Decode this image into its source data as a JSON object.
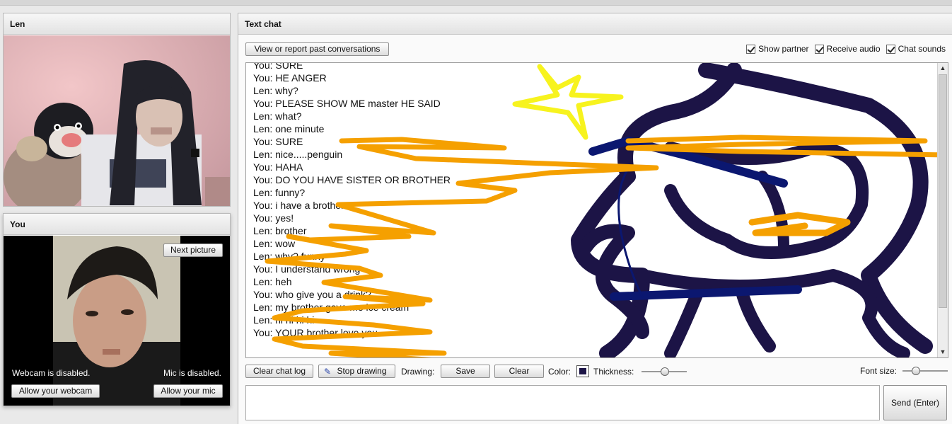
{
  "partner": {
    "name": "Len"
  },
  "self": {
    "title": "You",
    "next_picture_label": "Next picture",
    "webcam_status": "Webcam is disabled.",
    "mic_status": "Mic is disabled.",
    "allow_webcam_label": "Allow your webcam",
    "allow_mic_label": "Allow your mic"
  },
  "chat": {
    "title": "Text chat",
    "view_report_label": "View or report past conversations",
    "options": [
      {
        "label": "Show partner",
        "checked": true
      },
      {
        "label": "Receive audio",
        "checked": true
      },
      {
        "label": "Chat sounds",
        "checked": true
      }
    ],
    "messages": [
      {
        "speaker": "You:",
        "text": "SURE"
      },
      {
        "speaker": "You:",
        "text": "HE ANGER"
      },
      {
        "speaker": "Len:",
        "text": "why?"
      },
      {
        "speaker": "You:",
        "text": "PLEASE SHOW ME master HE SAID"
      },
      {
        "speaker": "Len:",
        "text": "what?"
      },
      {
        "speaker": "Len:",
        "text": "one minute"
      },
      {
        "speaker": "You:",
        "text": "SURE"
      },
      {
        "speaker": "Len:",
        "text": "nice.....penguin"
      },
      {
        "speaker": "You:",
        "text": "HAHA"
      },
      {
        "speaker": "You:",
        "text": "DO YOU HAVE SISTER OR BROTHER"
      },
      {
        "speaker": "Len:",
        "text": "funny?"
      },
      {
        "speaker": "You:",
        "text": "i have a brother"
      },
      {
        "speaker": "You:",
        "text": "yes!"
      },
      {
        "speaker": "Len:",
        "text": "brother"
      },
      {
        "speaker": "Len:",
        "text": "wow"
      },
      {
        "speaker": "Len:",
        "text": "why? funny"
      },
      {
        "speaker": "You:",
        "text": "I understand wrong"
      },
      {
        "speaker": "Len:",
        "text": "heh"
      },
      {
        "speaker": "You:",
        "text": "who give you a drink?"
      },
      {
        "speaker": "Len:",
        "text": "my brother gave me ice cream"
      },
      {
        "speaker": "Len:",
        "text": "hi hi hi hi"
      },
      {
        "speaker": "You:",
        "text": "YOUR brother love you"
      }
    ],
    "toolbar": {
      "clear_log_label": "Clear chat log",
      "stop_drawing_label": "Stop drawing",
      "drawing_label": "Drawing:",
      "save_label": "Save",
      "clear_label": "Clear",
      "color_label": "Color:",
      "thickness_label": "Thickness:",
      "font_size_label": "Font size:"
    },
    "send_label": "Send (Enter)",
    "message_value": ""
  },
  "colors": {
    "drawing_orange": "#f5a000",
    "drawing_navy": "#1c1446",
    "drawing_blue": "#0b1770",
    "drawing_yellow": "#f7f31e"
  },
  "icons": [
    "pencil-icon",
    "color-swatch-icon",
    "scroll-up-icon",
    "scroll-down-icon"
  ]
}
